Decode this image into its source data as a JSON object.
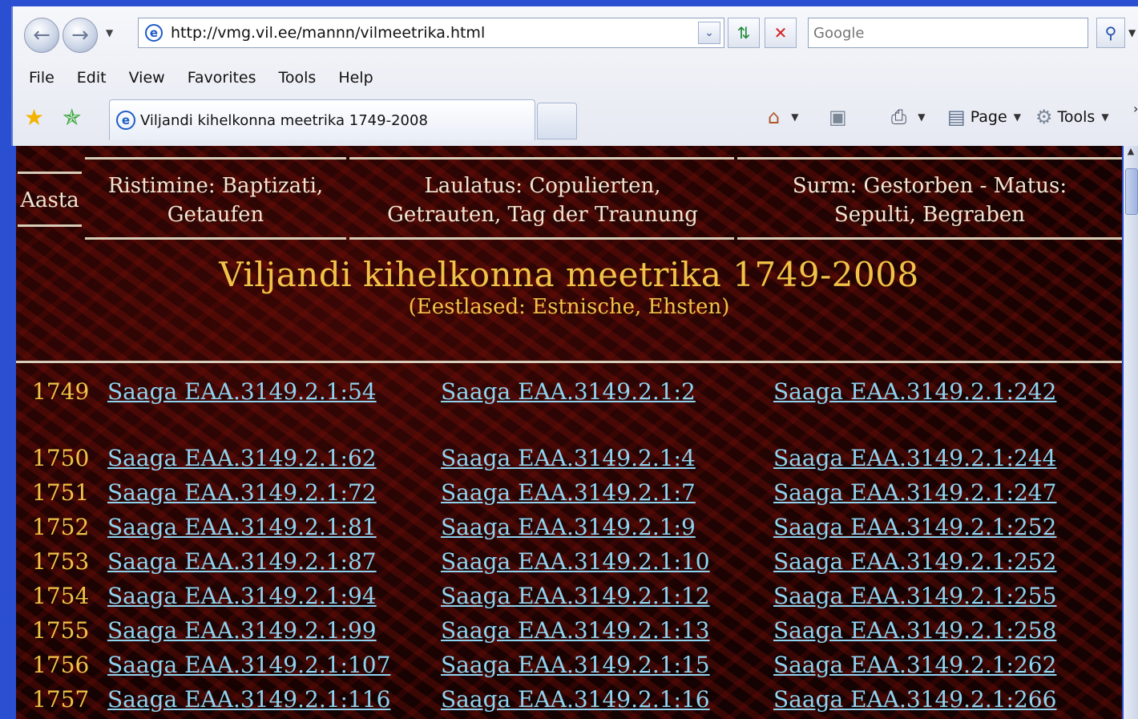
{
  "browser": {
    "address": "http://vmg.vil.ee/mannn/vilmeetrika.html",
    "search_placeholder": "Google",
    "menu": [
      "File",
      "Edit",
      "View",
      "Favorites",
      "Tools",
      "Help"
    ],
    "tab_title": "Viljandi kihelkonna meetrika 1749-2008",
    "page_label": "Page",
    "tools_label": "Tools"
  },
  "page": {
    "headers": {
      "year": "Aasta",
      "baptism_1": "Ristimine: Baptizati,",
      "baptism_2": "Getaufen",
      "marriage_1": "Laulatus: Copulierten,",
      "marriage_2": "Getrauten, Tag der Traunung",
      "death_1": "Surm: Gestorben - Matus:",
      "death_2": "Sepulti, Begraben"
    },
    "title": "Viljandi kihelkonna meetrika 1749-2008",
    "subtitle": "(Eestlased: Estnische, Ehsten)",
    "rows": [
      {
        "year": "1749",
        "baptism": "Saaga EAA.3149.2.1:54",
        "marriage": "Saaga EAA.3149.2.1:2",
        "death": "Saaga EAA.3149.2.1:242"
      },
      {
        "year": "1750",
        "baptism": "Saaga EAA.3149.2.1:62",
        "marriage": "Saaga EAA.3149.2.1:4",
        "death": "Saaga EAA.3149.2.1:244"
      },
      {
        "year": "1751",
        "baptism": "Saaga EAA.3149.2.1:72",
        "marriage": "Saaga EAA.3149.2.1:7",
        "death": "Saaga EAA.3149.2.1:247"
      },
      {
        "year": "1752",
        "baptism": "Saaga EAA.3149.2.1:81",
        "marriage": "Saaga EAA.3149.2.1:9",
        "death": "Saaga EAA.3149.2.1:252"
      },
      {
        "year": "1753",
        "baptism": "Saaga EAA.3149.2.1:87",
        "marriage": "Saaga EAA.3149.2.1:10",
        "death": "Saaga EAA.3149.2.1:252"
      },
      {
        "year": "1754",
        "baptism": "Saaga EAA.3149.2.1:94",
        "marriage": "Saaga EAA.3149.2.1:12",
        "death": "Saaga EAA.3149.2.1:255"
      },
      {
        "year": "1755",
        "baptism": "Saaga EAA.3149.2.1:99",
        "marriage": "Saaga EAA.3149.2.1:13",
        "death": "Saaga EAA.3149.2.1:258"
      },
      {
        "year": "1756",
        "baptism": "Saaga EAA.3149.2.1:107",
        "marriage": "Saaga EAA.3149.2.1:15",
        "death": "Saaga EAA.3149.2.1:262"
      },
      {
        "year": "1757",
        "baptism": "Saaga EAA.3149.2.1:116",
        "marriage": "Saaga EAA.3149.2.1:16",
        "death": "Saaga EAA.3149.2.1:266"
      }
    ]
  }
}
